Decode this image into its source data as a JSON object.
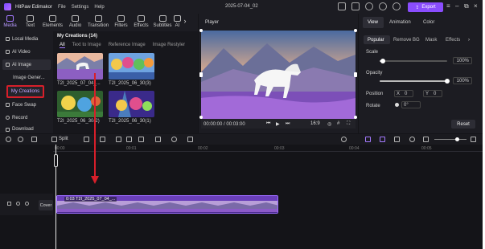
{
  "app": {
    "name": "HitPaw Edimakor",
    "menus": [
      "File",
      "Settings",
      "Help"
    ],
    "project_title": "2025-07-04_02",
    "export_label": "Export"
  },
  "media_tabs": [
    "Media",
    "Text",
    "Elements",
    "Audio",
    "Transition",
    "Filters",
    "Effects",
    "Subtitles",
    "AI"
  ],
  "left_nav": {
    "local_media": "Local Media",
    "ai_video": "AI Video",
    "ai_image": "AI Image",
    "image_gener": "Image Gener...",
    "my_creations": "My Creations",
    "face_swap": "Face Swap",
    "record": "Record",
    "download": "Download"
  },
  "library": {
    "title": "My Creations (14)",
    "tabs": [
      "All",
      "Text to Image",
      "Reference Image",
      "Image Restyler"
    ],
    "items": [
      {
        "label": "T2I_2025_07_04_..."
      },
      {
        "label": "T2I_2025_06_30(3)"
      },
      {
        "label": "T2I_2025_06_30(2)"
      },
      {
        "label": "T2I_2025_06_30(1)"
      }
    ]
  },
  "player": {
    "label": "Player",
    "timecode": "00:00:00 / 00:03:00",
    "aspect": "16:9"
  },
  "right_panel": {
    "tabs": [
      "View",
      "Animation",
      "Color"
    ],
    "subtabs": [
      "Popular",
      "Remove BG",
      "Mask",
      "Effects"
    ],
    "scale_label": "Scale",
    "scale_value": "100%",
    "scale_level": 0.05,
    "opacity_label": "Opacity",
    "opacity_value": "100%",
    "opacity_level": 1.0,
    "position_label": "Position",
    "pos_x_label": "X",
    "pos_x_value": "0",
    "pos_y_label": "Y",
    "pos_y_value": "0",
    "rotate_label": "Rotate",
    "rotate_value": "0°",
    "reset_label": "Reset"
  },
  "timeline": {
    "split_label": "Split",
    "ruler_ticks": [
      "00:00",
      "00:01",
      "00:02",
      "00:03",
      "00:04",
      "00:05"
    ],
    "cover_label": "Cover",
    "clip_label": "0:03 T2I_2025_07_04_..."
  },
  "colors": {
    "accent": "#8a4dff",
    "highlight_box": "#d71f2a",
    "background": "#141418"
  }
}
